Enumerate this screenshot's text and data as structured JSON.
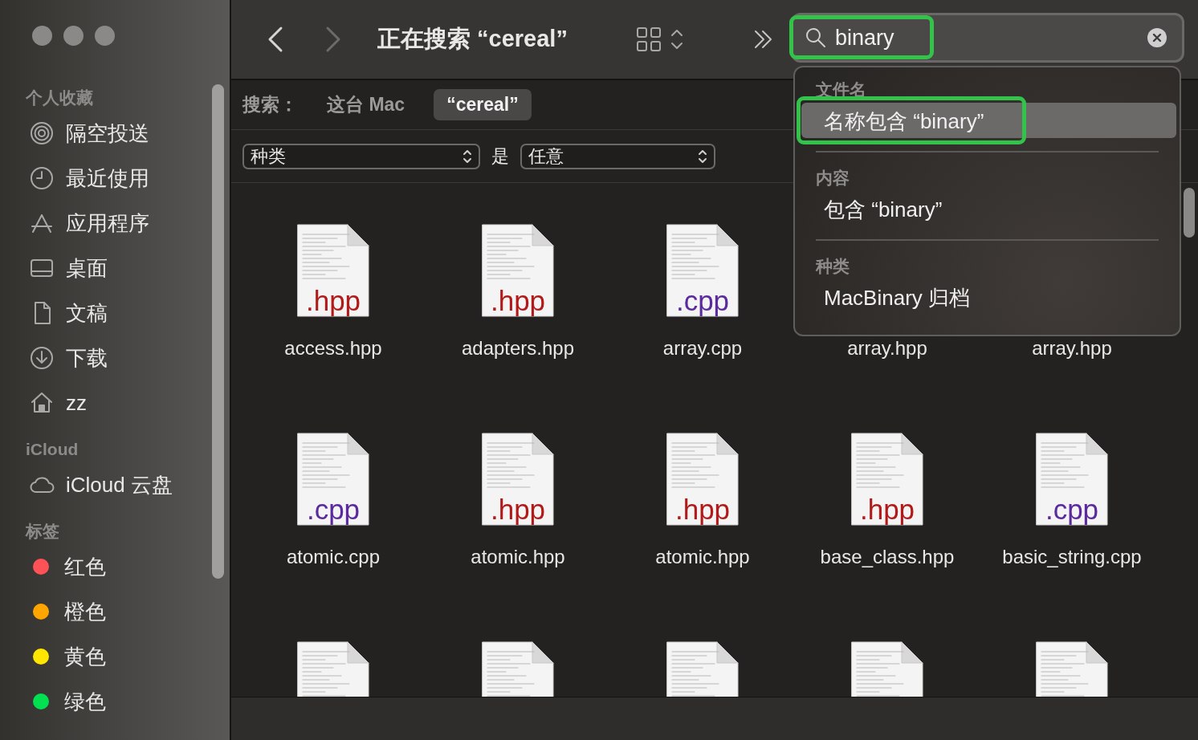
{
  "window": {
    "title": "正在搜索 “cereal”"
  },
  "sidebar": {
    "sections": [
      {
        "title": "个人收藏",
        "items": [
          {
            "kind": "place",
            "label": "隔空投送"
          },
          {
            "kind": "place",
            "label": "最近使用"
          },
          {
            "kind": "place",
            "label": "应用程序"
          },
          {
            "kind": "place",
            "label": "桌面"
          },
          {
            "kind": "place",
            "label": "文稿"
          },
          {
            "kind": "place",
            "label": "下载"
          },
          {
            "kind": "place",
            "label": "zz"
          }
        ]
      },
      {
        "title": "iCloud",
        "items": [
          {
            "kind": "place",
            "label": "iCloud 云盘"
          }
        ]
      },
      {
        "title": "标签",
        "items": [
          {
            "kind": "tag",
            "label": "红色",
            "color": "#ff5257"
          },
          {
            "kind": "tag",
            "label": "橙色",
            "color": "#ffa500"
          },
          {
            "kind": "tag",
            "label": "黄色",
            "color": "#ffe600"
          },
          {
            "kind": "tag",
            "label": "绿色",
            "color": "#00e050"
          }
        ]
      }
    ]
  },
  "search": {
    "value": "binary",
    "highlighted": true
  },
  "scope_bar": {
    "label": "搜索：",
    "scopes": [
      {
        "label": "这台 Mac",
        "selected": false
      },
      {
        "label": "“cereal”",
        "selected": true
      }
    ]
  },
  "filter": {
    "attribute": "种类",
    "operator": "是",
    "value": "任意"
  },
  "suggestions": [
    {
      "header": "文件名",
      "items": [
        {
          "label": "名称包含 “binary”",
          "selected": true,
          "highlighted": true
        }
      ]
    },
    {
      "header": "内容",
      "items": [
        {
          "label": "包含 “binary”",
          "selected": false,
          "highlighted": false
        }
      ]
    },
    {
      "header": "种类",
      "items": [
        {
          "label": "MacBinary 归档",
          "selected": false,
          "highlighted": false
        }
      ]
    }
  ],
  "files": [
    {
      "name": "access.hpp",
      "ext": ".hpp"
    },
    {
      "name": "adapters.hpp",
      "ext": ".hpp"
    },
    {
      "name": "array.cpp",
      "ext": ".cpp"
    },
    {
      "name": "array.hpp"
    },
    {
      "name": "array.hpp"
    },
    {
      "name": "atomic.cpp",
      "ext": ".cpp"
    },
    {
      "name": "atomic.hpp",
      "ext": ".hpp"
    },
    {
      "name": "atomic.hpp",
      "ext": ".hpp"
    },
    {
      "name": "base_class.hpp",
      "ext": ".hpp"
    },
    {
      "name": "basic_string.cpp",
      "ext": ".cpp"
    },
    {
      "kind": "partial"
    },
    {
      "kind": "partial"
    },
    {
      "kind": "partial"
    },
    {
      "kind": "partial"
    },
    {
      "kind": "partial"
    }
  ]
}
